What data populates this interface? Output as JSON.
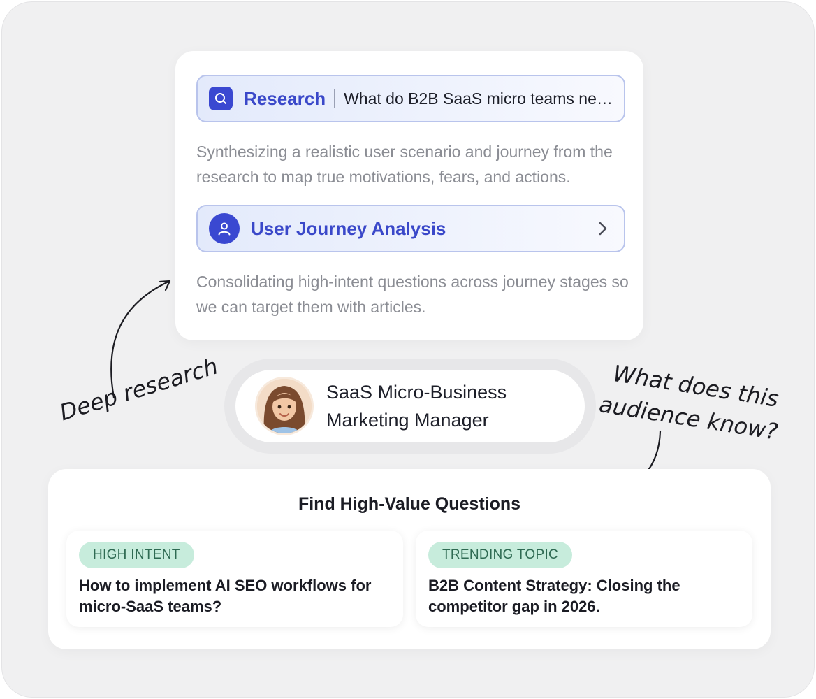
{
  "research_panel": {
    "research_label": "Research",
    "research_query": "What do B2B SaaS micro teams nee…",
    "research_description": "Synthesizing a realistic user scenario and journey from the research to map true motivations, fears, and actions.",
    "journey_label": "User Journey Analysis",
    "journey_description": "Consolidating high-intent questions across journey stages so we can target them with articles."
  },
  "persona": {
    "line1": "SaaS Micro-Business",
    "line2": "Marketing Manager"
  },
  "annotations": {
    "left": "Deep research",
    "right_line1": "What does this",
    "right_line2": "audience know?"
  },
  "questions_panel": {
    "title": "Find High-Value Questions",
    "cards": [
      {
        "tag": "HIGH INTENT",
        "text": "How to implement AI SEO workflows for micro-SaaS teams?"
      },
      {
        "tag": "TRENDING TOPIC",
        "text": "B2B Content Strategy: Closing the competitor gap in 2026."
      }
    ]
  },
  "colors": {
    "accent": "#3a48d1",
    "tag_bg": "#c7ecdc",
    "tag_text": "#2e6a52"
  },
  "icons": {
    "research": "search-icon",
    "journey": "user-icon",
    "chevron": "chevron-right-icon"
  }
}
